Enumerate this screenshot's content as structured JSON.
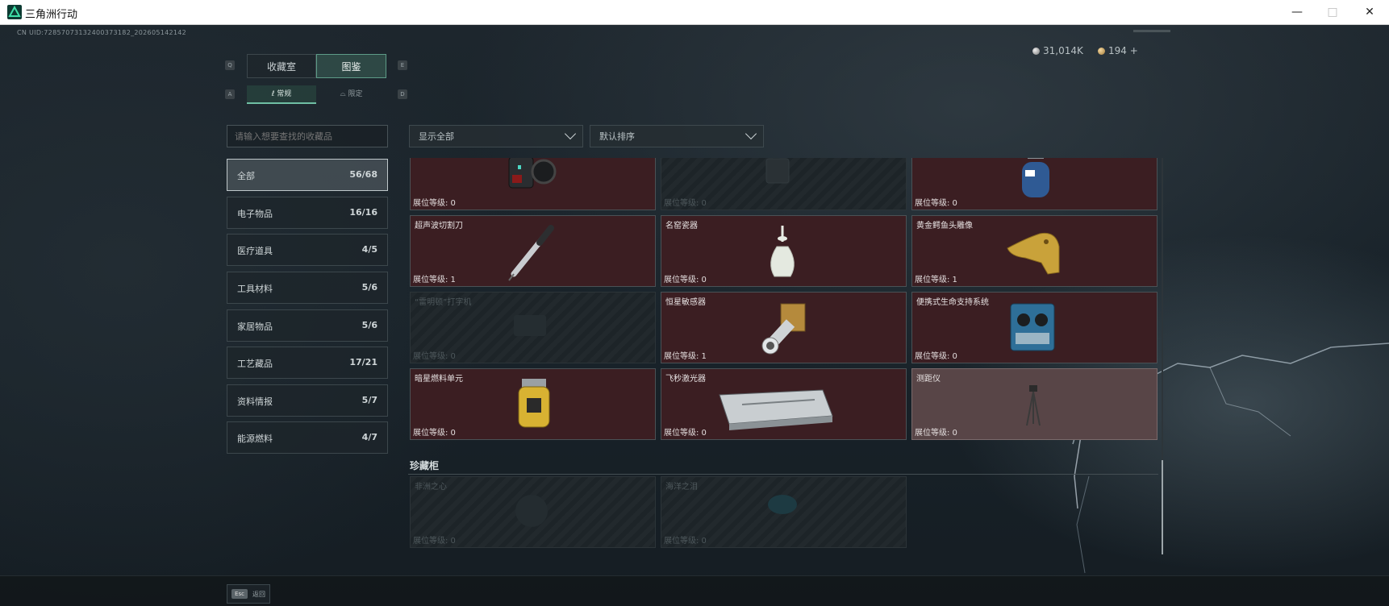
{
  "window": {
    "title": "三角洲行动"
  },
  "uid": "CN UID:7285707313240037318​2_202605142142",
  "currency": {
    "silver": "31,014K",
    "gold": "194 +"
  },
  "tabs": {
    "left_key": "Q",
    "right_key": "E",
    "collection_room": "收藏室",
    "catalog": "图鉴"
  },
  "subtabs": {
    "left_key": "A",
    "right_key": "D",
    "regular": "常规",
    "limited": "限定"
  },
  "search": {
    "placeholder": "请输入想要查找的收藏品"
  },
  "filters": {
    "show": "显示全部",
    "sort": "默认排序"
  },
  "categories": [
    {
      "label": "全部",
      "count": "56/68"
    },
    {
      "label": "电子物品",
      "count": "16/16"
    },
    {
      "label": "医疗道具",
      "count": "4/5"
    },
    {
      "label": "工具材料",
      "count": "5/6"
    },
    {
      "label": "家居物品",
      "count": "5/6"
    },
    {
      "label": "工艺藏品",
      "count": "17/21"
    },
    {
      "label": "资料情报",
      "count": "5/7"
    },
    {
      "label": "能源燃料",
      "count": "4/7"
    }
  ],
  "items": [
    {
      "name": "",
      "level": "展位等级: 0",
      "state": "owned",
      "icon": "mechanical-device-icon"
    },
    {
      "name": "",
      "level": "展位等级: 0",
      "state": "locked",
      "icon": "device-icon"
    },
    {
      "name": "",
      "level": "展位等级: 0",
      "state": "owned",
      "icon": "gas-canister-icon"
    },
    {
      "name": "超声波切割刀",
      "level": "展位等级: 1",
      "state": "owned",
      "icon": "ultrasonic-cutter-icon"
    },
    {
      "name": "名窑瓷器",
      "level": "展位等级: 0",
      "state": "owned",
      "icon": "porcelain-vase-icon"
    },
    {
      "name": "黄金鳄鱼头雕像",
      "level": "展位等级: 1",
      "state": "owned",
      "icon": "gold-crocodile-head-icon"
    },
    {
      "name": "“雷明顿”打字机",
      "level": "展位等级: 0",
      "state": "locked",
      "icon": "typewriter-icon"
    },
    {
      "name": "恒星敏感器",
      "level": "展位等级: 1",
      "state": "owned",
      "icon": "star-sensor-icon"
    },
    {
      "name": "便携式生命支持系统",
      "level": "展位等级: 0",
      "state": "owned",
      "icon": "life-support-icon"
    },
    {
      "name": "暗星燃料单元",
      "level": "展位等级: 0",
      "state": "owned",
      "icon": "fuel-cell-icon"
    },
    {
      "name": "飞秒激光器",
      "level": "展位等级: 0",
      "state": "owned",
      "icon": "femtosecond-laser-icon"
    },
    {
      "name": "测距仪",
      "level": "展位等级: 0",
      "state": "grey",
      "icon": "rangefinder-tripod-icon"
    }
  ],
  "treasure": {
    "title": "珍藏柜",
    "items": [
      {
        "name": "非洲之心",
        "level": "展位等级: 0",
        "state": "locked",
        "icon": "heart-of-africa-icon"
      },
      {
        "name": "海洋之泪",
        "level": "展位等级: 0",
        "state": "locked",
        "icon": "tear-of-ocean-icon"
      }
    ]
  },
  "bottom": {
    "esc_key": "Esc",
    "back_label": "返回"
  }
}
